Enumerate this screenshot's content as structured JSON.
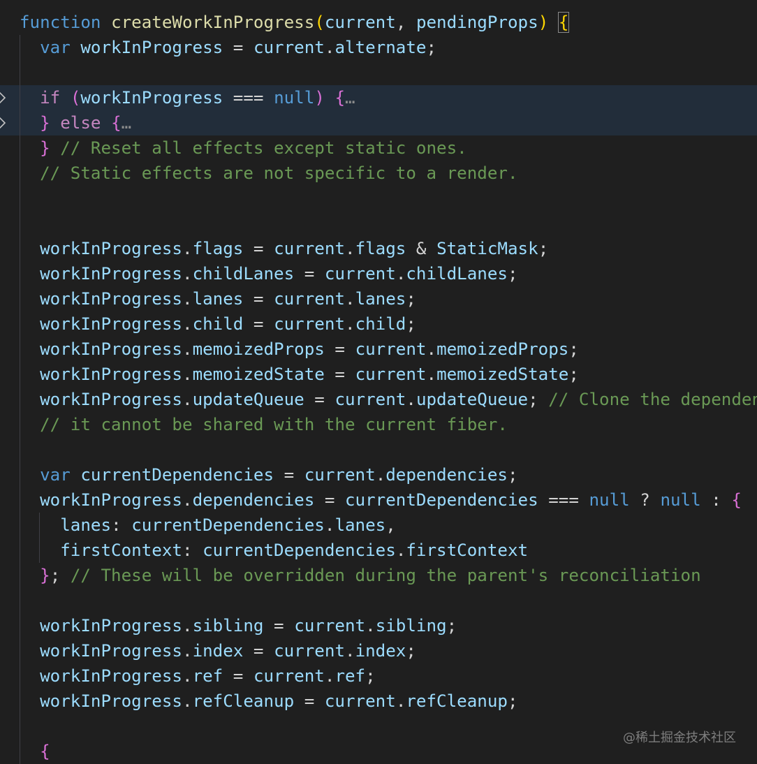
{
  "editor": {
    "lines": [
      [
        {
          "text": "function",
          "cls": "kw"
        },
        {
          "text": " ",
          "cls": "op"
        },
        {
          "text": "createWorkInProgress",
          "cls": "fn"
        },
        {
          "text": "(",
          "cls": "brc"
        },
        {
          "text": "current",
          "cls": "var"
        },
        {
          "text": ", ",
          "cls": "op"
        },
        {
          "text": "pendingProps",
          "cls": "var"
        },
        {
          "text": ")",
          "cls": "brc"
        },
        {
          "text": " ",
          "cls": "op"
        },
        {
          "text": "{",
          "cls": "brc",
          "match": true
        }
      ],
      [
        {
          "text": "  ",
          "cls": "op"
        },
        {
          "text": "var",
          "cls": "kw"
        },
        {
          "text": " ",
          "cls": "op"
        },
        {
          "text": "workInProgress",
          "cls": "var"
        },
        {
          "text": " = ",
          "cls": "op"
        },
        {
          "text": "current",
          "cls": "var"
        },
        {
          "text": ".",
          "cls": "op"
        },
        {
          "text": "alternate",
          "cls": "var"
        },
        {
          "text": ";",
          "cls": "op"
        }
      ],
      [],
      [
        {
          "text": "  ",
          "cls": "op"
        },
        {
          "text": "if",
          "cls": "ctl"
        },
        {
          "text": " ",
          "cls": "op"
        },
        {
          "text": "(",
          "cls": "par"
        },
        {
          "text": "workInProgress",
          "cls": "var"
        },
        {
          "text": " === ",
          "cls": "op"
        },
        {
          "text": "null",
          "cls": "kw"
        },
        {
          "text": ")",
          "cls": "par"
        },
        {
          "text": " ",
          "cls": "op"
        },
        {
          "text": "{",
          "cls": "par"
        },
        {
          "text": "…",
          "cls": "dots"
        }
      ],
      [
        {
          "text": "  ",
          "cls": "op"
        },
        {
          "text": "}",
          "cls": "par"
        },
        {
          "text": " ",
          "cls": "op"
        },
        {
          "text": "else",
          "cls": "ctl"
        },
        {
          "text": " ",
          "cls": "op"
        },
        {
          "text": "{",
          "cls": "par"
        },
        {
          "text": "…",
          "cls": "dots"
        }
      ],
      [
        {
          "text": "  ",
          "cls": "op"
        },
        {
          "text": "}",
          "cls": "par"
        },
        {
          "text": " ",
          "cls": "op"
        },
        {
          "text": "// Reset all effects except static ones.",
          "cls": "cmt"
        }
      ],
      [
        {
          "text": "  ",
          "cls": "op"
        },
        {
          "text": "// Static effects are not specific to a render.",
          "cls": "cmt"
        }
      ],
      [],
      [],
      [
        {
          "text": "  ",
          "cls": "op"
        },
        {
          "text": "workInProgress",
          "cls": "var"
        },
        {
          "text": ".",
          "cls": "op"
        },
        {
          "text": "flags",
          "cls": "var"
        },
        {
          "text": " = ",
          "cls": "op"
        },
        {
          "text": "current",
          "cls": "var"
        },
        {
          "text": ".",
          "cls": "op"
        },
        {
          "text": "flags",
          "cls": "var"
        },
        {
          "text": " & ",
          "cls": "op"
        },
        {
          "text": "StaticMask",
          "cls": "var"
        },
        {
          "text": ";",
          "cls": "op"
        }
      ],
      [
        {
          "text": "  ",
          "cls": "op"
        },
        {
          "text": "workInProgress",
          "cls": "var"
        },
        {
          "text": ".",
          "cls": "op"
        },
        {
          "text": "childLanes",
          "cls": "var"
        },
        {
          "text": " = ",
          "cls": "op"
        },
        {
          "text": "current",
          "cls": "var"
        },
        {
          "text": ".",
          "cls": "op"
        },
        {
          "text": "childLanes",
          "cls": "var"
        },
        {
          "text": ";",
          "cls": "op"
        }
      ],
      [
        {
          "text": "  ",
          "cls": "op"
        },
        {
          "text": "workInProgress",
          "cls": "var"
        },
        {
          "text": ".",
          "cls": "op"
        },
        {
          "text": "lanes",
          "cls": "var"
        },
        {
          "text": " = ",
          "cls": "op"
        },
        {
          "text": "current",
          "cls": "var"
        },
        {
          "text": ".",
          "cls": "op"
        },
        {
          "text": "lanes",
          "cls": "var"
        },
        {
          "text": ";",
          "cls": "op"
        }
      ],
      [
        {
          "text": "  ",
          "cls": "op"
        },
        {
          "text": "workInProgress",
          "cls": "var"
        },
        {
          "text": ".",
          "cls": "op"
        },
        {
          "text": "child",
          "cls": "var"
        },
        {
          "text": " = ",
          "cls": "op"
        },
        {
          "text": "current",
          "cls": "var"
        },
        {
          "text": ".",
          "cls": "op"
        },
        {
          "text": "child",
          "cls": "var"
        },
        {
          "text": ";",
          "cls": "op"
        }
      ],
      [
        {
          "text": "  ",
          "cls": "op"
        },
        {
          "text": "workInProgress",
          "cls": "var"
        },
        {
          "text": ".",
          "cls": "op"
        },
        {
          "text": "memoizedProps",
          "cls": "var"
        },
        {
          "text": " = ",
          "cls": "op"
        },
        {
          "text": "current",
          "cls": "var"
        },
        {
          "text": ".",
          "cls": "op"
        },
        {
          "text": "memoizedProps",
          "cls": "var"
        },
        {
          "text": ";",
          "cls": "op"
        }
      ],
      [
        {
          "text": "  ",
          "cls": "op"
        },
        {
          "text": "workInProgress",
          "cls": "var"
        },
        {
          "text": ".",
          "cls": "op"
        },
        {
          "text": "memoizedState",
          "cls": "var"
        },
        {
          "text": " = ",
          "cls": "op"
        },
        {
          "text": "current",
          "cls": "var"
        },
        {
          "text": ".",
          "cls": "op"
        },
        {
          "text": "memoizedState",
          "cls": "var"
        },
        {
          "text": ";",
          "cls": "op"
        }
      ],
      [
        {
          "text": "  ",
          "cls": "op"
        },
        {
          "text": "workInProgress",
          "cls": "var"
        },
        {
          "text": ".",
          "cls": "op"
        },
        {
          "text": "updateQueue",
          "cls": "var"
        },
        {
          "text": " = ",
          "cls": "op"
        },
        {
          "text": "current",
          "cls": "var"
        },
        {
          "text": ".",
          "cls": "op"
        },
        {
          "text": "updateQueue",
          "cls": "var"
        },
        {
          "text": "; ",
          "cls": "op"
        },
        {
          "text": "// Clone the dependenc",
          "cls": "cmt"
        }
      ],
      [
        {
          "text": "  ",
          "cls": "op"
        },
        {
          "text": "// it cannot be shared with the current fiber.",
          "cls": "cmt"
        }
      ],
      [],
      [
        {
          "text": "  ",
          "cls": "op"
        },
        {
          "text": "var",
          "cls": "kw"
        },
        {
          "text": " ",
          "cls": "op"
        },
        {
          "text": "currentDependencies",
          "cls": "var"
        },
        {
          "text": " = ",
          "cls": "op"
        },
        {
          "text": "current",
          "cls": "var"
        },
        {
          "text": ".",
          "cls": "op"
        },
        {
          "text": "dependencies",
          "cls": "var"
        },
        {
          "text": ";",
          "cls": "op"
        }
      ],
      [
        {
          "text": "  ",
          "cls": "op"
        },
        {
          "text": "workInProgress",
          "cls": "var"
        },
        {
          "text": ".",
          "cls": "op"
        },
        {
          "text": "dependencies",
          "cls": "var"
        },
        {
          "text": " = ",
          "cls": "op"
        },
        {
          "text": "currentDependencies",
          "cls": "var"
        },
        {
          "text": " === ",
          "cls": "op"
        },
        {
          "text": "null",
          "cls": "kw"
        },
        {
          "text": " ? ",
          "cls": "op"
        },
        {
          "text": "null",
          "cls": "kw"
        },
        {
          "text": " : ",
          "cls": "op"
        },
        {
          "text": "{",
          "cls": "par"
        }
      ],
      [
        {
          "text": "    ",
          "cls": "op"
        },
        {
          "text": "lanes",
          "cls": "var"
        },
        {
          "text": ": ",
          "cls": "op"
        },
        {
          "text": "currentDependencies",
          "cls": "var"
        },
        {
          "text": ".",
          "cls": "op"
        },
        {
          "text": "lanes",
          "cls": "var"
        },
        {
          "text": ",",
          "cls": "op"
        }
      ],
      [
        {
          "text": "    ",
          "cls": "op"
        },
        {
          "text": "firstContext",
          "cls": "var"
        },
        {
          "text": ": ",
          "cls": "op"
        },
        {
          "text": "currentDependencies",
          "cls": "var"
        },
        {
          "text": ".",
          "cls": "op"
        },
        {
          "text": "firstContext",
          "cls": "var"
        }
      ],
      [
        {
          "text": "  ",
          "cls": "op"
        },
        {
          "text": "}",
          "cls": "par"
        },
        {
          "text": "; ",
          "cls": "op"
        },
        {
          "text": "// These will be overridden during the parent's reconciliation",
          "cls": "cmt"
        }
      ],
      [],
      [
        {
          "text": "  ",
          "cls": "op"
        },
        {
          "text": "workInProgress",
          "cls": "var"
        },
        {
          "text": ".",
          "cls": "op"
        },
        {
          "text": "sibling",
          "cls": "var"
        },
        {
          "text": " = ",
          "cls": "op"
        },
        {
          "text": "current",
          "cls": "var"
        },
        {
          "text": ".",
          "cls": "op"
        },
        {
          "text": "sibling",
          "cls": "var"
        },
        {
          "text": ";",
          "cls": "op"
        }
      ],
      [
        {
          "text": "  ",
          "cls": "op"
        },
        {
          "text": "workInProgress",
          "cls": "var"
        },
        {
          "text": ".",
          "cls": "op"
        },
        {
          "text": "index",
          "cls": "var"
        },
        {
          "text": " = ",
          "cls": "op"
        },
        {
          "text": "current",
          "cls": "var"
        },
        {
          "text": ".",
          "cls": "op"
        },
        {
          "text": "index",
          "cls": "var"
        },
        {
          "text": ";",
          "cls": "op"
        }
      ],
      [
        {
          "text": "  ",
          "cls": "op"
        },
        {
          "text": "workInProgress",
          "cls": "var"
        },
        {
          "text": ".",
          "cls": "op"
        },
        {
          "text": "ref",
          "cls": "var"
        },
        {
          "text": " = ",
          "cls": "op"
        },
        {
          "text": "current",
          "cls": "var"
        },
        {
          "text": ".",
          "cls": "op"
        },
        {
          "text": "ref",
          "cls": "var"
        },
        {
          "text": ";",
          "cls": "op"
        }
      ],
      [
        {
          "text": "  ",
          "cls": "op"
        },
        {
          "text": "workInProgress",
          "cls": "var"
        },
        {
          "text": ".",
          "cls": "op"
        },
        {
          "text": "refCleanup",
          "cls": "var"
        },
        {
          "text": " = ",
          "cls": "op"
        },
        {
          "text": "current",
          "cls": "var"
        },
        {
          "text": ".",
          "cls": "op"
        },
        {
          "text": "refCleanup",
          "cls": "var"
        },
        {
          "text": ";",
          "cls": "op"
        }
      ],
      [],
      [
        {
          "text": "  ",
          "cls": "op"
        },
        {
          "text": "{",
          "cls": "par"
        }
      ]
    ],
    "folded_line_indices": [
      3,
      4
    ],
    "highlighted_line_indices": [
      3,
      4
    ],
    "colors": {
      "background": "#1f1f1f",
      "highlight_band": "#222d3a",
      "keyword": "#569cd6",
      "control": "#c586c0",
      "function": "#dcdcaa",
      "variable": "#9cdcfe",
      "operator": "#d4d4d4",
      "comment": "#6a9955",
      "bracket_pink": "#da70d6",
      "bracket_gold": "#ffd700"
    }
  },
  "watermark": {
    "text": "@稀土掘金技术社区"
  },
  "icons": {
    "fold": "chevron-right-icon"
  }
}
